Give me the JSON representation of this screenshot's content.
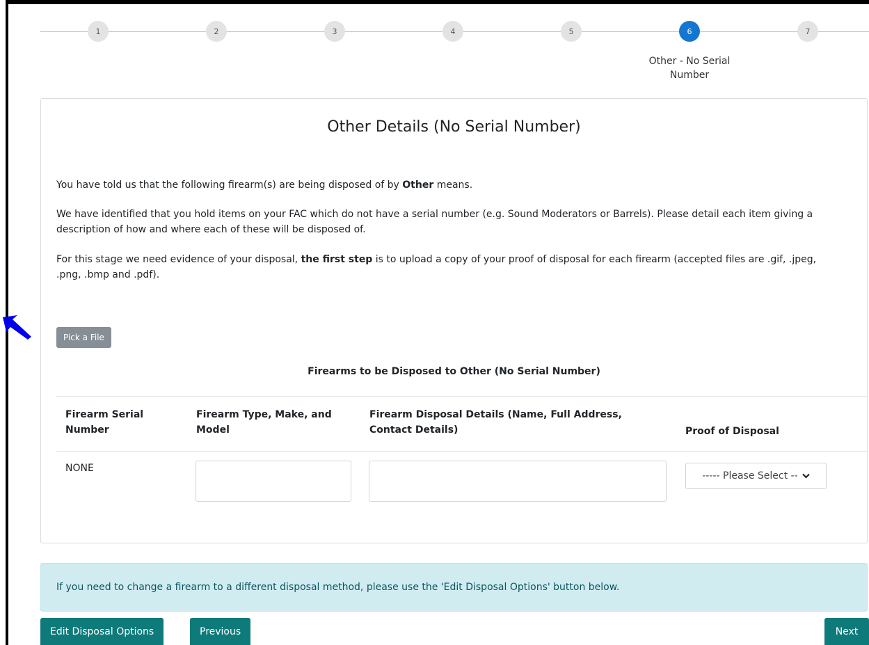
{
  "stepper": {
    "steps": [
      "1",
      "2",
      "3",
      "4",
      "5",
      "6",
      "7"
    ],
    "active_step": "6",
    "active_caption": "Other - No Serial Number"
  },
  "card": {
    "title": "Other Details (No Serial Number)",
    "intro_prefix": "You have told us that the following firearm(s) are being disposed of by ",
    "intro_bold": "Other",
    "intro_suffix": " means.",
    "identified_text": "We have identified that you hold items on your FAC which do not have a serial number (e.g. Sound Moderators or Barrels). Please detail each item giving a description of how and where each of these will be disposed of.",
    "evidence_prefix": "For this stage we need evidence of your disposal, ",
    "evidence_bold": "the first step",
    "evidence_suffix": " is to upload a copy of your proof of disposal for each firearm (accepted files are .gif, .jpeg, .png, .bmp and .pdf).",
    "pick_file_label": "Pick a File"
  },
  "table": {
    "caption": "Firearms to be Disposed to Other (No Serial Number)",
    "headers": [
      "Firearm Serial Number",
      "Firearm Type, Make, and Model",
      "Firearm Disposal Details (Name, Full Address, Contact Details)",
      "Proof of Disposal"
    ],
    "rows": [
      {
        "serial": "NONE",
        "type_make_model": "",
        "disposal_details": "",
        "proof_select": "----- Please Select --"
      }
    ]
  },
  "alert": {
    "text": "If you need to change a firearm to a different disposal method, please use the 'Edit Disposal Options' button below."
  },
  "actions": {
    "edit_label": "Edit Disposal Options",
    "previous_label": "Previous",
    "next_label": "Next"
  },
  "colors": {
    "active_step": "#1377d2",
    "teal_button": "#0f7a7a",
    "alert_bg": "#d1ecf1",
    "annotation_arrow": "#0000ee"
  },
  "icons": {
    "annotation": "arrow-pointer-icon",
    "select": "chevron-down-icon"
  }
}
